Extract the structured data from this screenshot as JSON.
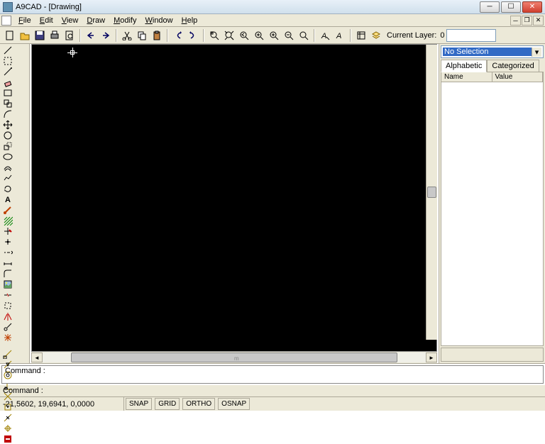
{
  "window": {
    "title": "A9CAD - [Drawing]"
  },
  "menus": [
    "File",
    "Edit",
    "View",
    "Draw",
    "Modify",
    "Window",
    "Help"
  ],
  "toolbar": {
    "current_layer_label": "Current Layer:",
    "current_layer_value": "0"
  },
  "properties": {
    "selection_text": "No Selection",
    "tabs": {
      "alphabetic": "Alphabetic",
      "categorized": "Categorized"
    },
    "columns": {
      "name": "Name",
      "value": "Value"
    }
  },
  "command": {
    "log_prompt": "Command :",
    "prompt": "Command :"
  },
  "status": {
    "coords": "-21,5602, 19,6941, 0,0000",
    "snap": "SNAP",
    "grid": "GRID",
    "ortho": "ORTHO",
    "osnap": "OSNAP"
  },
  "hscroll_mark": "m"
}
